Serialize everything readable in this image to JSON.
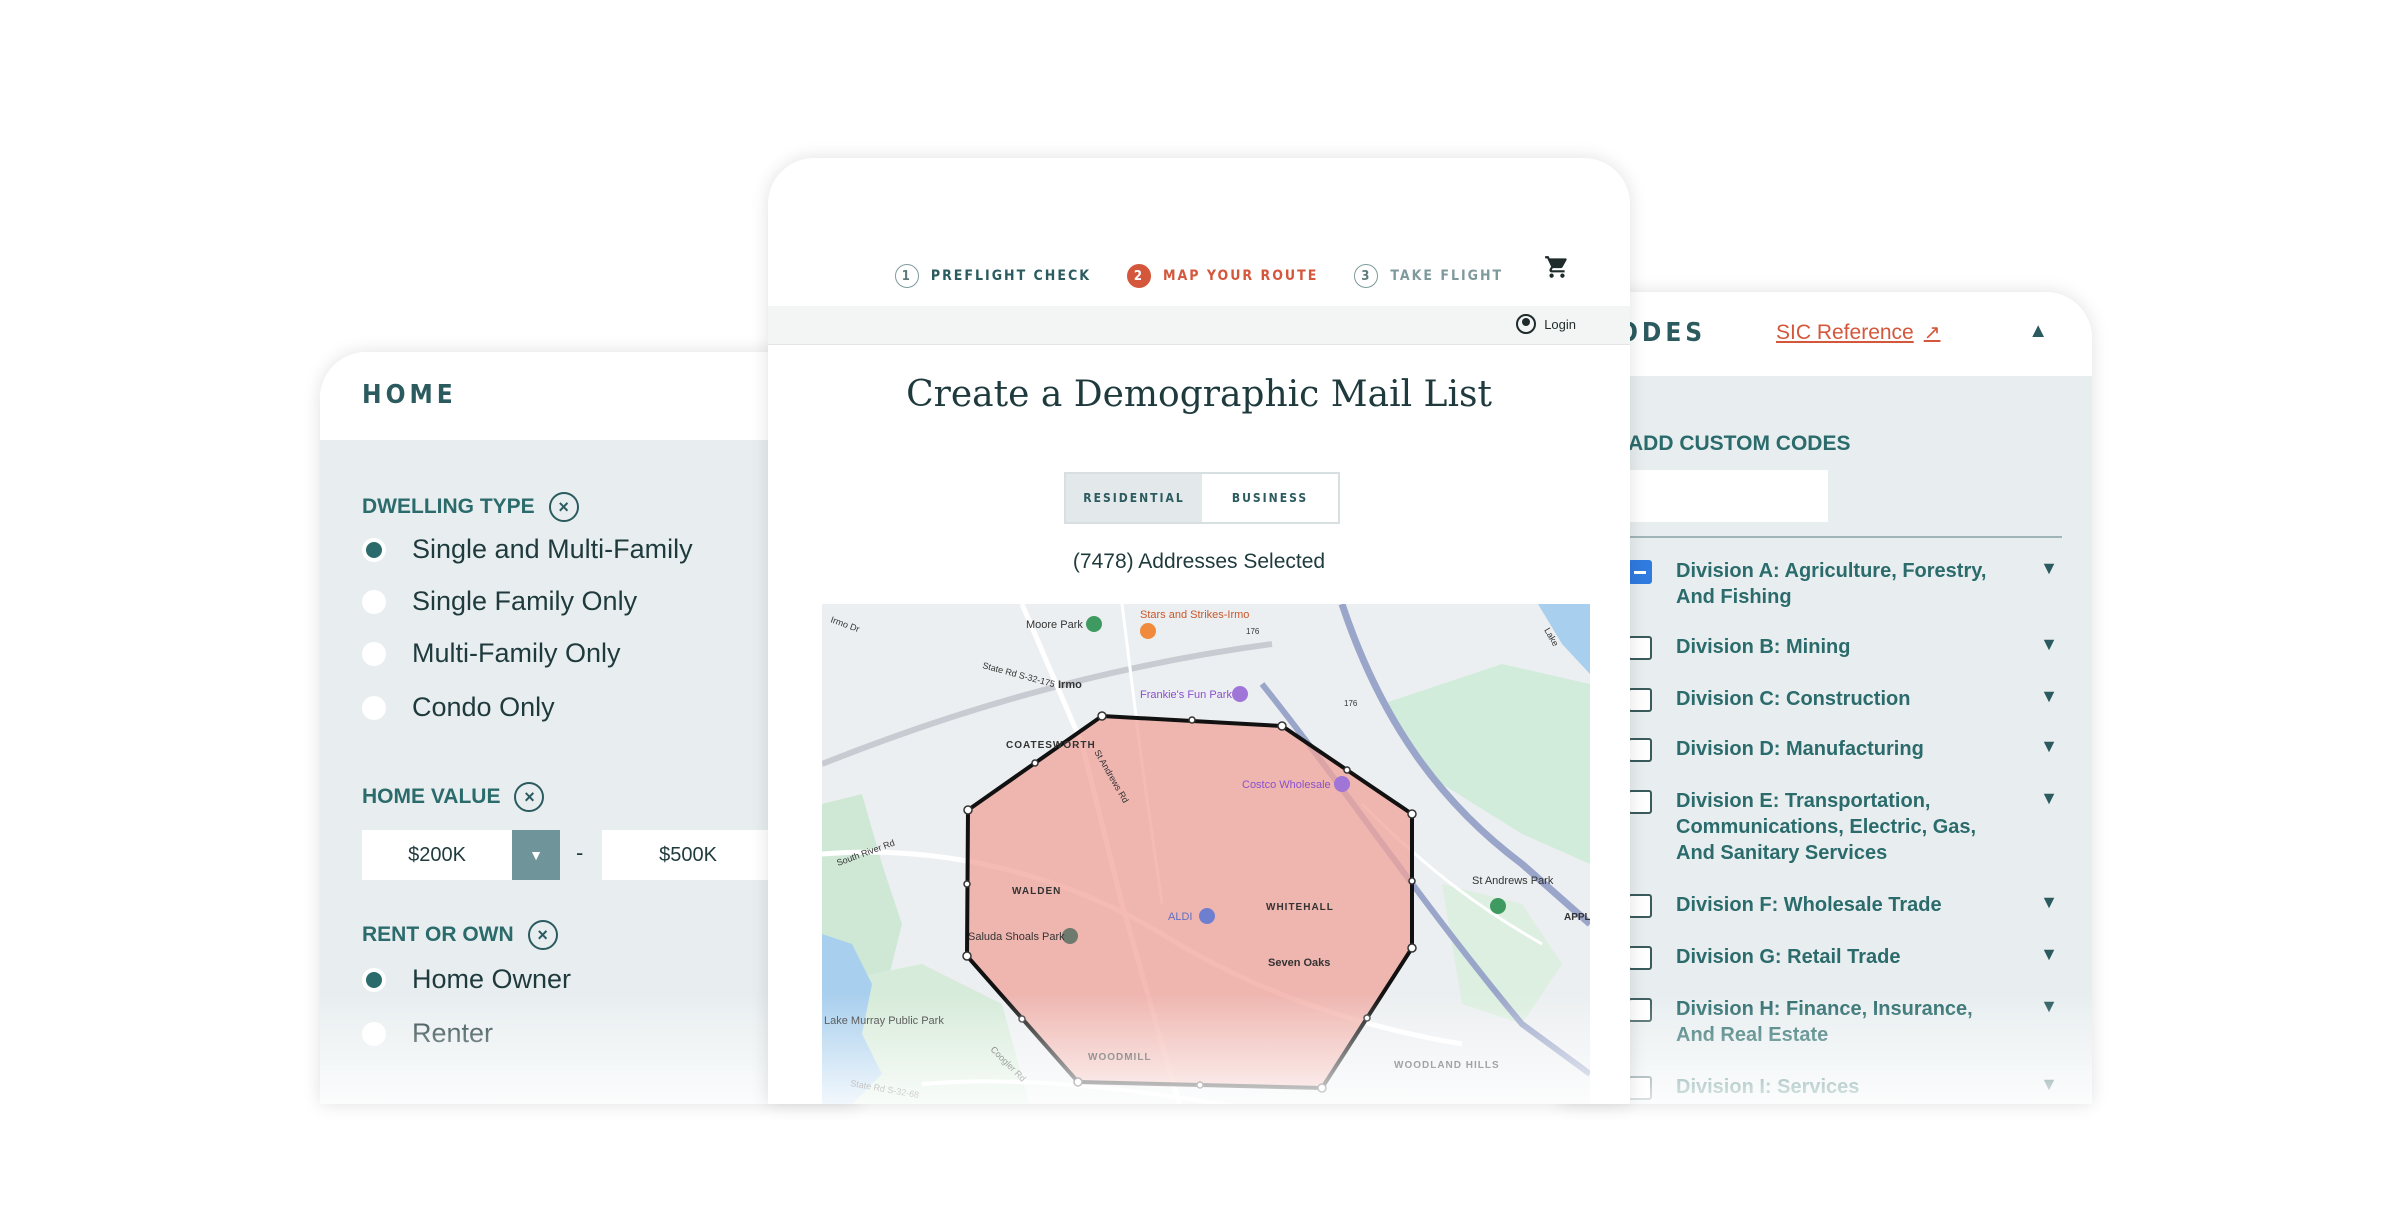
{
  "home": {
    "title": "HOME",
    "dwelling_label": "DWELLING TYPE",
    "dwelling_options": [
      {
        "label": "Single and Multi-Family",
        "selected": true
      },
      {
        "label": "Single Family Only",
        "selected": false
      },
      {
        "label": "Multi-Family Only",
        "selected": false
      },
      {
        "label": "Condo Only",
        "selected": false
      }
    ],
    "value_label": "HOME VALUE",
    "value_min": "$200K",
    "value_max": "$500K",
    "value_sep": "-",
    "rent_label": "RENT OR OWN",
    "rent_options": [
      {
        "label": "Home Owner",
        "selected": true
      },
      {
        "label": "Renter",
        "selected": false
      }
    ]
  },
  "center": {
    "steps": [
      {
        "num": "1",
        "label": "PREFLIGHT CHECK",
        "state": "done"
      },
      {
        "num": "2",
        "label": "MAP YOUR ROUTE",
        "state": "active"
      },
      {
        "num": "3",
        "label": "TAKE FLIGHT",
        "state": "future"
      }
    ],
    "login": "Login",
    "title": "Create a Demographic Mail List",
    "toggle_residential": "RESIDENTIAL",
    "toggle_business": "BUSINESS",
    "addresses": "(7478) Addresses Selected",
    "map_labels": {
      "moore_park": "Moore Park",
      "stars": "Stars and Strikes-Irmo",
      "irmo": "Irmo",
      "frankies": "Frankie's Fun Park",
      "coatesworth": "COATESWORTH",
      "costco": "Costco Wholesale",
      "walden": "WALDEN",
      "whitehall": "WHITEHALL",
      "aldi": "ALDI",
      "saluda": "Saluda Shoals Park",
      "seven_oaks": "Seven Oaks",
      "st_andrews": "St Andrews Park",
      "lake_murray": "Lake Murray Public Park",
      "woodmill": "WOODMILL",
      "woodland_hills": "WOODLAND HILLS",
      "appl": "APPL",
      "irmo_dr": "Irmo Dr",
      "state_rd_175": "State Rd S-32-175",
      "st_andrews_rd": "St Andrews Rd",
      "south_river": "South River Rd",
      "state_rd_68": "State Rd S-32-68",
      "rt_176": "176",
      "rt_176b": "176",
      "lake": "Lake",
      "coogler": "Coogler Rd"
    }
  },
  "sic": {
    "title": "SIC CODES",
    "reference": "SIC Reference",
    "custom_label": "ADD CUSTOM CODES",
    "divisions": [
      {
        "label": "Division A: Agriculture, Forestry, And Fishing",
        "state": "partial"
      },
      {
        "label": "Division B: Mining",
        "state": "unchecked"
      },
      {
        "label": "Division C: Construction",
        "state": "unchecked"
      },
      {
        "label": "Division D: Manufacturing",
        "state": "unchecked"
      },
      {
        "label": "Division E: Transportation, Communications, Electric, Gas, And Sanitary Services",
        "state": "unchecked"
      },
      {
        "label": "Division F: Wholesale Trade",
        "state": "unchecked"
      },
      {
        "label": "Division G: Retail Trade",
        "state": "unchecked"
      },
      {
        "label": "Division H: Finance, Insurance, And Real Estate",
        "state": "unchecked"
      },
      {
        "label": "Division I: Services",
        "state": "unchecked"
      }
    ]
  },
  "icons": {
    "cart": "cart-icon",
    "user": "user-icon",
    "clear": "clear-icon",
    "external": "external-link-icon",
    "collapse": "chevron-up-icon",
    "expand": "chevron-down-icon"
  },
  "colors": {
    "primary": "#2b5b5f",
    "accent": "#d4573c",
    "panel": "#e8eef0",
    "polygon": "#f0a39a"
  }
}
